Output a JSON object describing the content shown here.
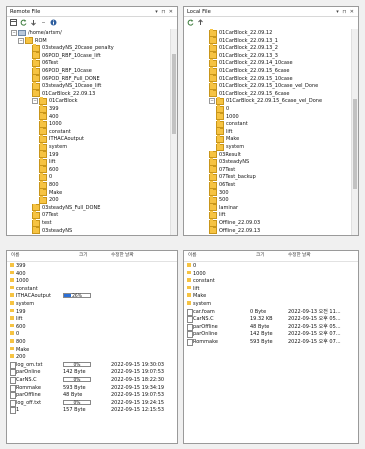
{
  "remote": {
    "title": "Remote File",
    "controls": "▾ ⊓ ✕",
    "tree": [
      {
        "label": "/home/artsm/",
        "icon": "drive",
        "expander": "−"
      },
      {
        "label": "ROM",
        "icon": "folder",
        "expander": "−"
      },
      {
        "label": "03steadyNS_20case_penalty",
        "icon": "folder",
        "expander": ""
      },
      {
        "label": "06POD_RBF_10case_lift",
        "icon": "folder",
        "expander": ""
      },
      {
        "label": "06Test",
        "icon": "folder",
        "expander": ""
      },
      {
        "label": "06POD_RBF_10case",
        "icon": "folder",
        "expander": ""
      },
      {
        "label": "06POD_RBF_Full_DONE",
        "icon": "folder",
        "expander": ""
      },
      {
        "label": "03steadyNS_10case_lift",
        "icon": "folder",
        "expander": ""
      },
      {
        "label": "01CarBlock_22.09.13",
        "icon": "folder",
        "expander": ""
      },
      {
        "label": "01CarBlock",
        "icon": "folder",
        "expander": "−"
      },
      {
        "label": "399",
        "icon": "folder",
        "expander": ""
      },
      {
        "label": "400",
        "icon": "folder",
        "expander": ""
      },
      {
        "label": "1000",
        "icon": "folder",
        "expander": ""
      },
      {
        "label": "constant",
        "icon": "folder",
        "expander": ""
      },
      {
        "label": "ITHACAoutput",
        "icon": "folder",
        "expander": ""
      },
      {
        "label": "system",
        "icon": "folder",
        "expander": ""
      },
      {
        "label": "199",
        "icon": "folder",
        "expander": ""
      },
      {
        "label": "lift",
        "icon": "folder",
        "expander": ""
      },
      {
        "label": "600",
        "icon": "folder",
        "expander": ""
      },
      {
        "label": "0",
        "icon": "folder",
        "expander": ""
      },
      {
        "label": "800",
        "icon": "folder",
        "expander": ""
      },
      {
        "label": "Make",
        "icon": "folder",
        "expander": ""
      },
      {
        "label": "200",
        "icon": "folder",
        "expander": ""
      },
      {
        "label": "03steadyNS_Full_DONE",
        "icon": "folder",
        "expander": ""
      },
      {
        "label": "07Test",
        "icon": "folder",
        "expander": ""
      },
      {
        "label": "test",
        "icon": "folder",
        "expander": ""
      },
      {
        "label": "03steadyNS",
        "icon": "folder",
        "expander": ""
      }
    ],
    "list_headers": {
      "name": "이름",
      "size": "크기",
      "modified": "수정한 날짜"
    },
    "list": [
      {
        "name": "399",
        "type": "folder",
        "size": "",
        "date": "",
        "progress": ""
      },
      {
        "name": "400",
        "type": "folder",
        "size": "",
        "date": "",
        "progress": ""
      },
      {
        "name": "1000",
        "type": "folder",
        "size": "",
        "date": "",
        "progress": ""
      },
      {
        "name": "constant",
        "type": "folder",
        "size": "",
        "date": "",
        "progress": ""
      },
      {
        "name": "ITHACAoutput",
        "type": "folder",
        "size": "",
        "date": "",
        "progress": "26%",
        "progress_value": 0.26
      },
      {
        "name": "system",
        "type": "folder",
        "size": "",
        "date": "",
        "progress": ""
      },
      {
        "name": "199",
        "type": "folder",
        "size": "",
        "date": "",
        "progress": ""
      },
      {
        "name": "lift",
        "type": "folder",
        "size": "",
        "date": "",
        "progress": ""
      },
      {
        "name": "600",
        "type": "folder",
        "size": "",
        "date": "",
        "progress": ""
      },
      {
        "name": "0",
        "type": "folder",
        "size": "",
        "date": "",
        "progress": ""
      },
      {
        "name": "800",
        "type": "folder",
        "size": "",
        "date": "",
        "progress": ""
      },
      {
        "name": "Make",
        "type": "folder",
        "size": "",
        "date": "",
        "progress": ""
      },
      {
        "name": "200",
        "type": "folder",
        "size": "",
        "date": "",
        "progress": ""
      },
      {
        "name": "log_om.txt",
        "type": "file",
        "size": "",
        "date": "2022-09-15 19:30:03",
        "progress": "0%",
        "progress_value": 0
      },
      {
        "name": "parOnline",
        "type": "file",
        "size": "142 Byte",
        "date": "2022-09-15 19:07:53",
        "progress": ""
      },
      {
        "name": "CarNS.C",
        "type": "file",
        "size": "",
        "date": "2022-09-15 18:22:30",
        "progress": "0%",
        "progress_value": 0
      },
      {
        "name": "Rommake",
        "type": "file",
        "size": "593 Byte",
        "date": "2022-09-15 19:34:19",
        "progress": ""
      },
      {
        "name": "parOffline",
        "type": "file",
        "size": "48 Byte",
        "date": "2022-09-15 19:07:53",
        "progress": ""
      },
      {
        "name": "log_off.txt",
        "type": "file",
        "size": "",
        "date": "2022-09-15 19:24:15",
        "progress": "0%",
        "progress_value": 0
      },
      {
        "name": "1",
        "type": "file",
        "size": "157 Byte",
        "date": "2022-09-15 12:15:53",
        "progress": ""
      }
    ]
  },
  "local": {
    "title": "Local File",
    "controls": "▾ ⊓ ✕",
    "tree": [
      {
        "label": "01CarBlock_22.09.12",
        "expander": ""
      },
      {
        "label": "01CarBlock_22.09.13_1",
        "expander": ""
      },
      {
        "label": "01CarBlock_22.09.13_2",
        "expander": ""
      },
      {
        "label": "01CarBlock_22.09.13_3",
        "expander": ""
      },
      {
        "label": "01CarBlock_22.09.14_10case",
        "expander": ""
      },
      {
        "label": "01CarBlock_22.09.15_6case",
        "expander": ""
      },
      {
        "label": "01CarBlock_22.09.15_10case",
        "expander": ""
      },
      {
        "label": "01CarBlock_22.09.15_10case_vel_Done",
        "expander": ""
      },
      {
        "label": "01CarBlock_22.09.15_6case",
        "expander": ""
      },
      {
        "label": "01CarBlock_22.09.15_6case_vel_Done",
        "expander": "−"
      },
      {
        "label": "0",
        "expander": ""
      },
      {
        "label": "1000",
        "expander": ""
      },
      {
        "label": "constant",
        "expander": ""
      },
      {
        "label": "lift",
        "expander": ""
      },
      {
        "label": "Make",
        "expander": ""
      },
      {
        "label": "system",
        "expander": ""
      },
      {
        "label": "03Result",
        "expander": ""
      },
      {
        "label": "03steadyNS",
        "expander": ""
      },
      {
        "label": "07Test",
        "expander": ""
      },
      {
        "label": "07Test_backup",
        "expander": ""
      },
      {
        "label": "06Test",
        "expander": ""
      },
      {
        "label": "300",
        "expander": ""
      },
      {
        "label": "500",
        "expander": ""
      },
      {
        "label": "laminar",
        "expander": ""
      },
      {
        "label": "lift",
        "expander": ""
      },
      {
        "label": "Offline_22.09.03",
        "expander": ""
      },
      {
        "label": "Offline_22.09.13",
        "expander": ""
      }
    ],
    "list_headers": {
      "name": "이름",
      "size": "크기",
      "modified": "수정한 날짜"
    },
    "list": [
      {
        "name": "0",
        "type": "folder",
        "size": "",
        "date": ""
      },
      {
        "name": "1000",
        "type": "folder",
        "size": "",
        "date": ""
      },
      {
        "name": "constant",
        "type": "folder",
        "size": "",
        "date": ""
      },
      {
        "name": "lift",
        "type": "folder",
        "size": "",
        "date": ""
      },
      {
        "name": "Make",
        "type": "folder",
        "size": "",
        "date": ""
      },
      {
        "name": "system",
        "type": "folder",
        "size": "",
        "date": ""
      },
      {
        "name": "car.foam",
        "type": "file",
        "size": "0 Byte",
        "date": "2022-09-13 오전 11..."
      },
      {
        "name": "CarNS.C",
        "type": "file",
        "size": "19.32 KB",
        "date": "2022-09-15 오후 05..."
      },
      {
        "name": "parOffline",
        "type": "file",
        "size": "48 Byte",
        "date": "2022-09-15 오후 05..."
      },
      {
        "name": "parOnline",
        "type": "file",
        "size": "142 Byte",
        "date": "2022-09-15 오후 07..."
      },
      {
        "name": "Rommake",
        "type": "file",
        "size": "593 Byte",
        "date": "2022-09-15 오후 07..."
      }
    ]
  },
  "colors": {
    "folder": "#f6c342",
    "progress": "#2b6fd6",
    "selection": "#cfe3fb"
  }
}
